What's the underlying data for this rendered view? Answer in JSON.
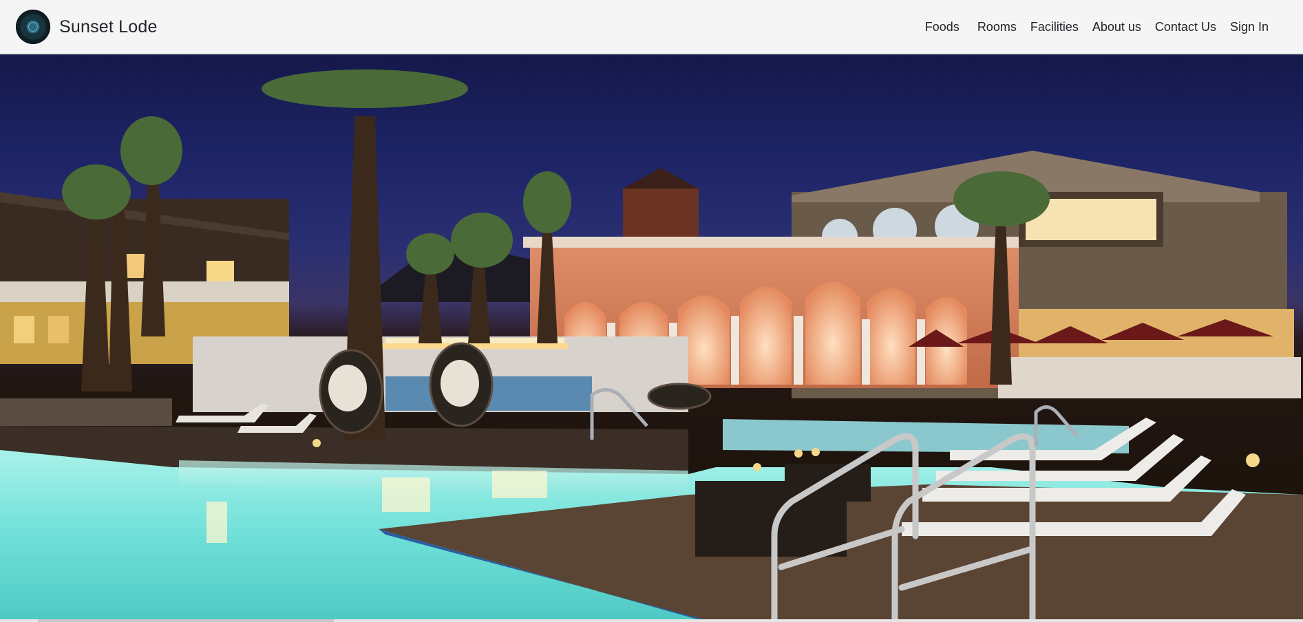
{
  "brand": {
    "name": "Sunset Lode",
    "logo_icon": "compass-emblem-icon"
  },
  "nav": {
    "items": [
      {
        "label": "Foods"
      },
      {
        "label": "Rooms"
      },
      {
        "label": "Facilities"
      },
      {
        "label": "About us"
      },
      {
        "label": "Contact Us"
      },
      {
        "label": "Sign In"
      }
    ]
  },
  "hero": {
    "subject": "resort-pool-at-night-photo"
  },
  "colors": {
    "navbar_bg": "#f5f5f5",
    "text": "#212529",
    "sky": "#1d2466",
    "pool": "#7fe7e0"
  }
}
